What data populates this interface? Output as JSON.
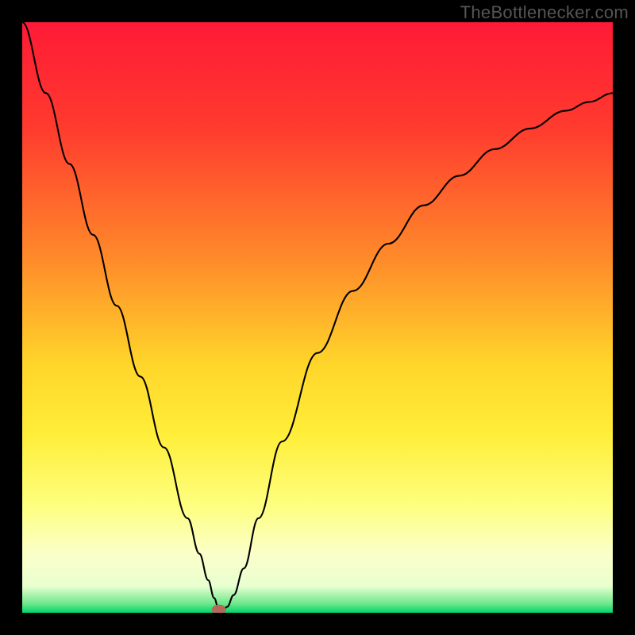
{
  "attribution": "TheBottlenecker.com",
  "chart_data": {
    "type": "line",
    "title": "",
    "xlabel": "",
    "ylabel": "",
    "xlim": [
      0,
      1
    ],
    "ylim": [
      0,
      1
    ],
    "gradient_stops": [
      {
        "offset": 0.0,
        "color": "#ff1a36"
      },
      {
        "offset": 0.18,
        "color": "#ff3b2e"
      },
      {
        "offset": 0.4,
        "color": "#ff8a2a"
      },
      {
        "offset": 0.58,
        "color": "#ffd62a"
      },
      {
        "offset": 0.7,
        "color": "#ffee3a"
      },
      {
        "offset": 0.82,
        "color": "#fdff80"
      },
      {
        "offset": 0.9,
        "color": "#fbffc9"
      },
      {
        "offset": 0.955,
        "color": "#e9ffd0"
      },
      {
        "offset": 0.985,
        "color": "#6be78b"
      },
      {
        "offset": 1.0,
        "color": "#00d46a"
      }
    ],
    "series": [
      {
        "name": "bottleneck-curve",
        "x": [
          0.0,
          0.04,
          0.08,
          0.12,
          0.16,
          0.2,
          0.24,
          0.28,
          0.3,
          0.315,
          0.325,
          0.333,
          0.34,
          0.347,
          0.358,
          0.375,
          0.4,
          0.44,
          0.5,
          0.56,
          0.62,
          0.68,
          0.74,
          0.8,
          0.86,
          0.92,
          0.96,
          1.0
        ],
        "y": [
          1.0,
          0.88,
          0.76,
          0.64,
          0.52,
          0.4,
          0.28,
          0.16,
          0.1,
          0.055,
          0.025,
          0.005,
          0.005,
          0.01,
          0.03,
          0.075,
          0.16,
          0.29,
          0.44,
          0.545,
          0.625,
          0.69,
          0.74,
          0.785,
          0.82,
          0.85,
          0.865,
          0.88
        ]
      }
    ],
    "marker": {
      "x": 0.333,
      "y": 0.005,
      "rx": 0.012,
      "ry": 0.009
    }
  }
}
